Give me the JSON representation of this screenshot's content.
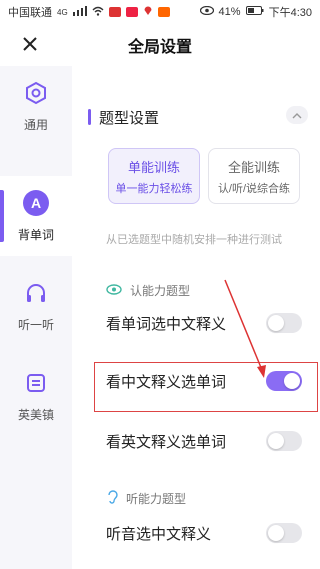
{
  "status_bar": {
    "carrier": "中国联通",
    "network": "4G",
    "battery": "41%",
    "time": "下午4:30"
  },
  "nav": {
    "title": "全局设置",
    "close_icon": "close-icon"
  },
  "sidebar": {
    "items": [
      {
        "label": "通用",
        "icon": "hexagon-gear-icon",
        "active": false
      },
      {
        "label": "背单词",
        "icon": "letter-a-icon",
        "active": true
      },
      {
        "label": "听一听",
        "icon": "headphones-icon",
        "active": false
      },
      {
        "label": "英美镇",
        "icon": "book-icon",
        "active": false
      }
    ],
    "active_letter": "A"
  },
  "section": {
    "title": "题型设置",
    "collapse_icon": "chevron-up-icon"
  },
  "modes": [
    {
      "title": "单能训练",
      "subtitle": "单一能力轻松练",
      "selected": true
    },
    {
      "title": "全能训练",
      "subtitle": "认/听/说综合练",
      "selected": false
    }
  ],
  "hint": "从已选题型中随机安排一种进行测试",
  "groups": [
    {
      "label": "认能力题型",
      "icon": "eye-icon"
    },
    {
      "label": "听能力题型",
      "icon": "ear-icon"
    }
  ],
  "options": [
    {
      "label": "看单词选中文释义",
      "enabled": false
    },
    {
      "label": "看中文释义选单词",
      "enabled": true
    },
    {
      "label": "看英文释义选单词",
      "enabled": false
    },
    {
      "label": "听音选中文释义",
      "enabled": false
    }
  ],
  "colors": {
    "accent": "#7b5cf0",
    "toggle_on": "#8a6cf4",
    "annotation": "#dd4444"
  }
}
